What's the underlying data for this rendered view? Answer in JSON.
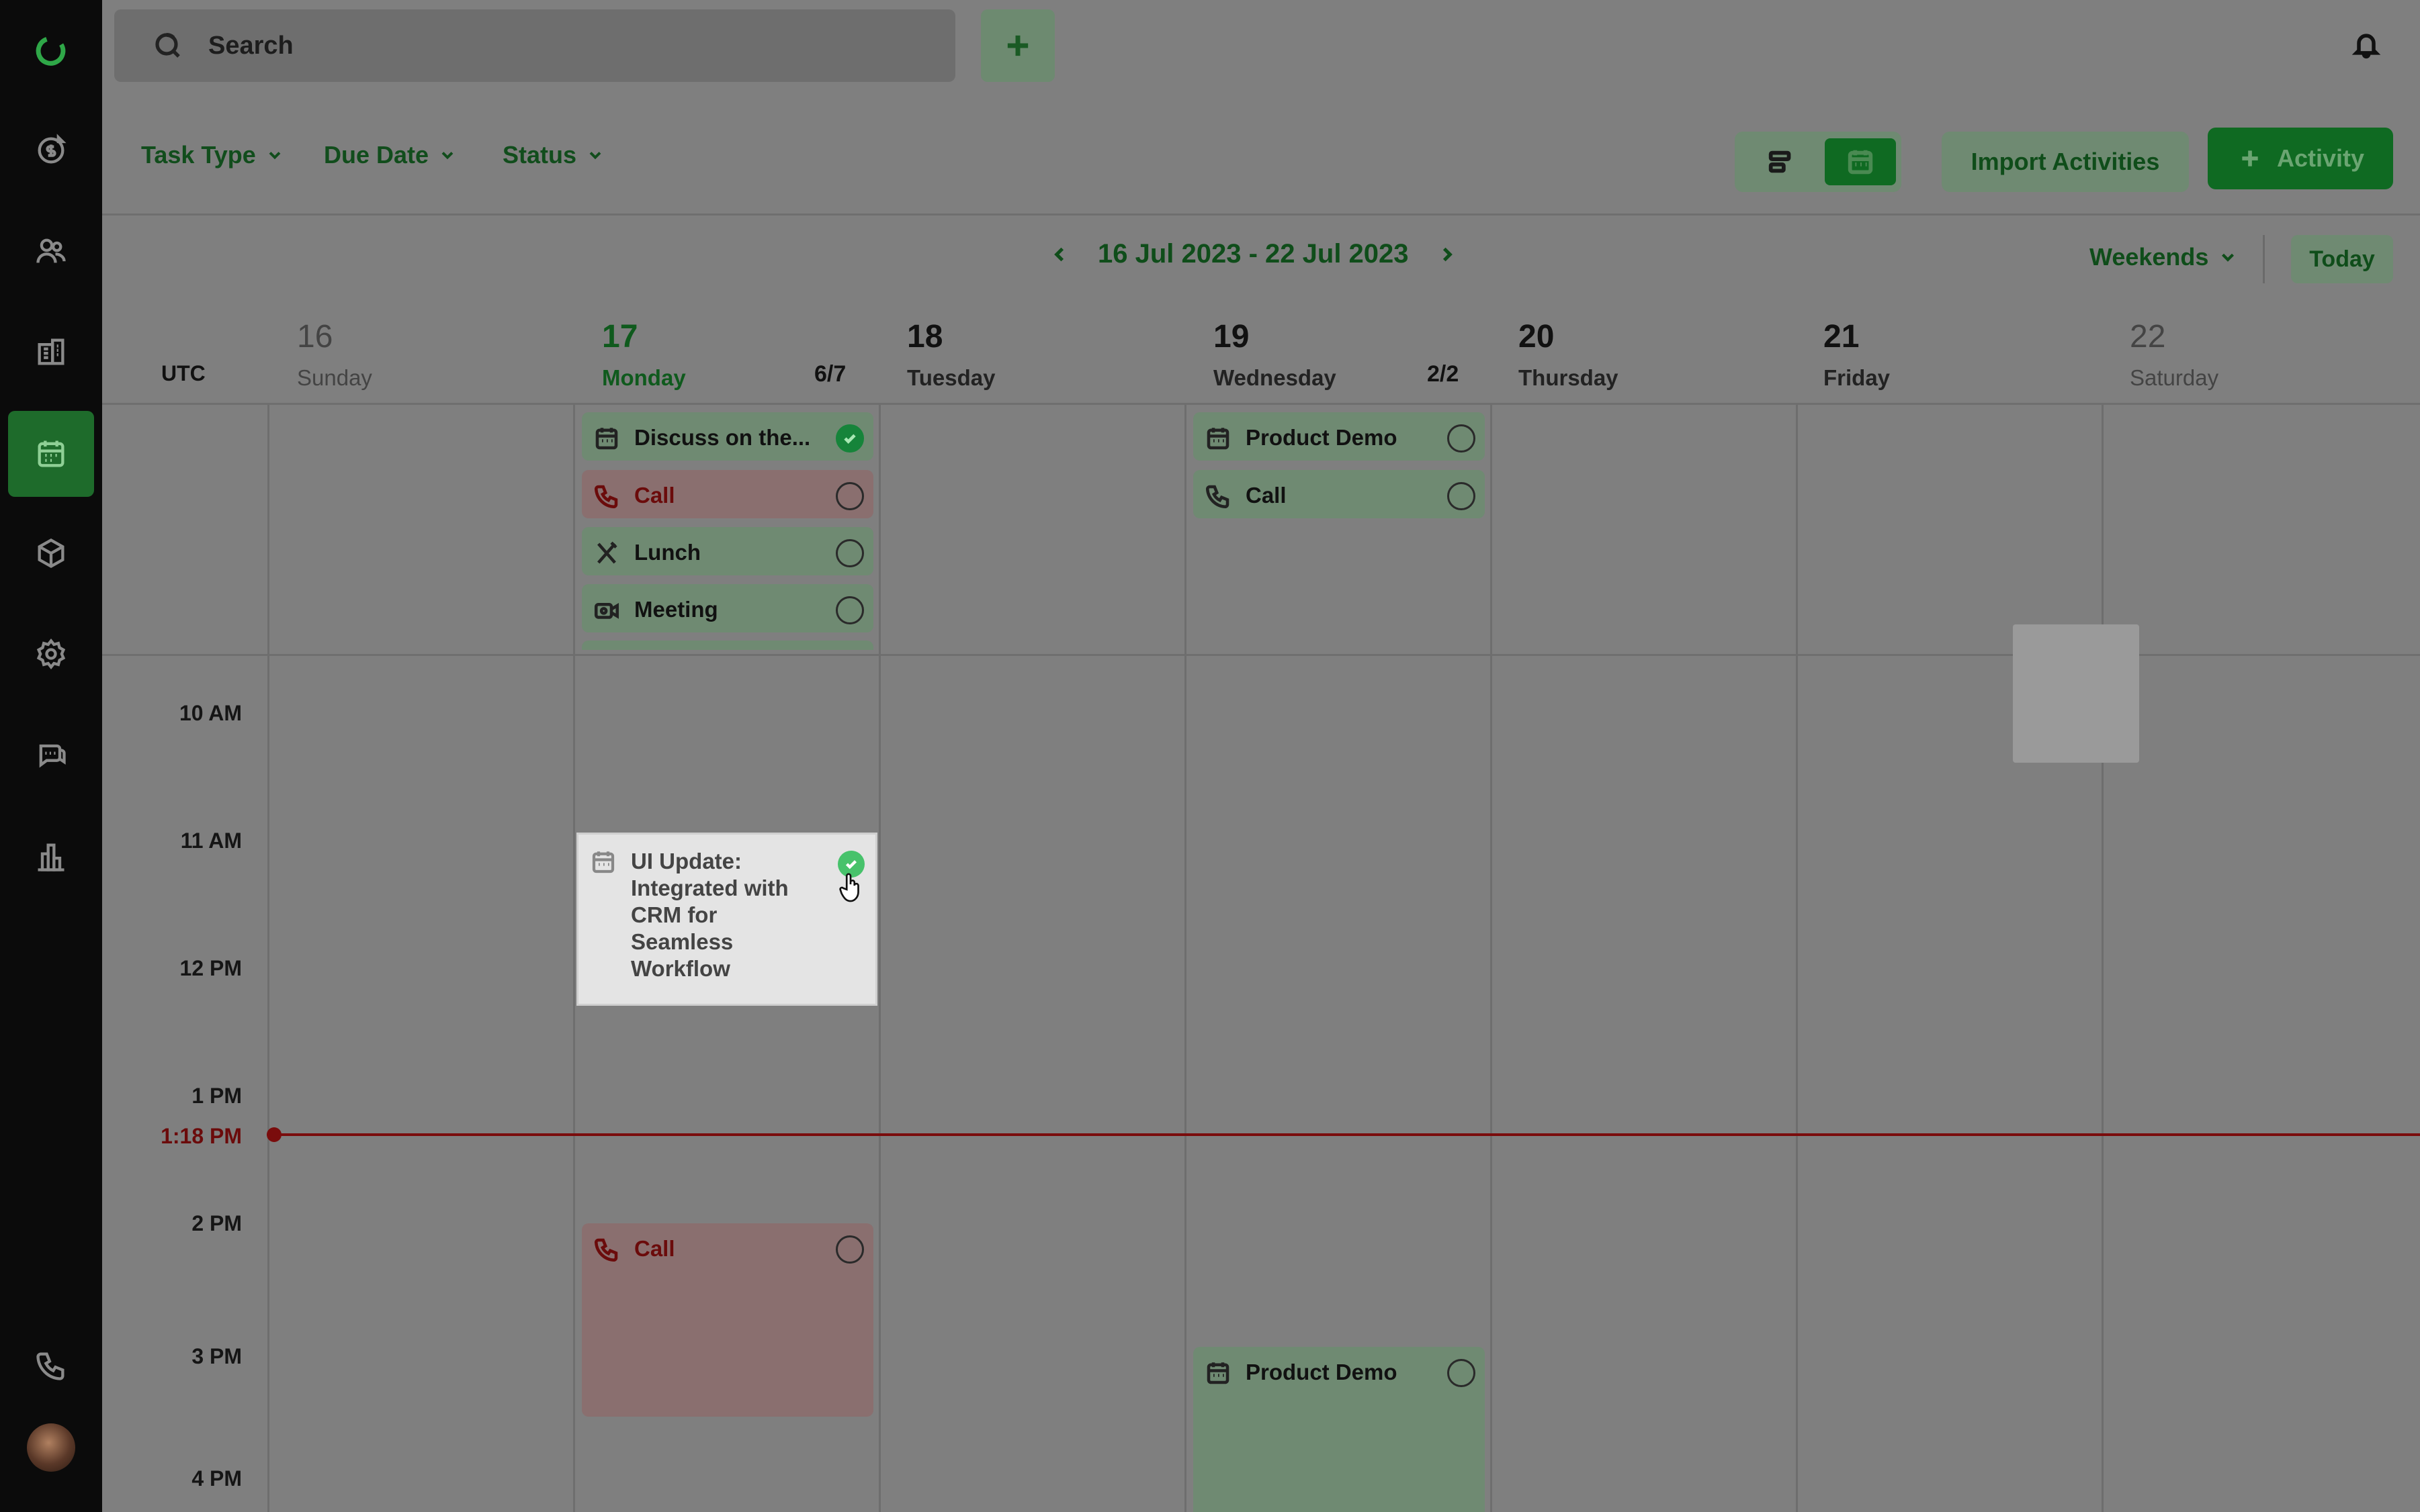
{
  "search": {
    "placeholder": "Search"
  },
  "filters": [
    {
      "label": "Task Type"
    },
    {
      "label": "Due Date"
    },
    {
      "label": "Status"
    }
  ],
  "toolbar": {
    "import_label": "Import Activities",
    "activity_label": "Activity",
    "active_view": "calendar"
  },
  "date_nav": {
    "range": "16 Jul 2023 - 22 Jul 2023",
    "weekends_label": "Weekends",
    "today_label": "Today"
  },
  "calendar": {
    "timezone": "UTC",
    "days": [
      {
        "num": "16",
        "name": "Sunday",
        "count": ""
      },
      {
        "num": "17",
        "name": "Monday",
        "count": "6/7"
      },
      {
        "num": "18",
        "name": "Tuesday",
        "count": ""
      },
      {
        "num": "19",
        "name": "Wednesday",
        "count": "2/2"
      },
      {
        "num": "20",
        "name": "Thursday",
        "count": ""
      },
      {
        "num": "21",
        "name": "Friday",
        "count": ""
      },
      {
        "num": "22",
        "name": "Saturday",
        "count": ""
      }
    ],
    "times": [
      "10 AM",
      "11 AM",
      "12 PM",
      "1 PM",
      "2 PM",
      "3 PM",
      "4 PM"
    ],
    "now_label": "1:18 PM",
    "allday": {
      "monday": [
        {
          "title": "Discuss on the...",
          "type": "event",
          "done": true
        },
        {
          "title": "Call",
          "type": "call",
          "done": false
        },
        {
          "title": "Lunch",
          "type": "lunch",
          "done": false
        },
        {
          "title": "Meeting",
          "type": "meeting",
          "done": false
        }
      ],
      "wednesday": [
        {
          "title": "Product Demo",
          "type": "event",
          "done": false
        },
        {
          "title": "Call",
          "type": "call",
          "done": false
        }
      ]
    },
    "timed": {
      "monday_call": {
        "title": "Call",
        "done": false
      },
      "wednesday_demo": {
        "title": "Product Demo",
        "done": false
      }
    },
    "popup": {
      "title": "UI Update: Integrated with CRM for Seamless Workflow",
      "done": true
    }
  },
  "colors": {
    "accent": "#0f6a22",
    "call_red": "#6b0b0b",
    "now_line": "#7a0c0c"
  },
  "icons": [
    "logo-icon",
    "deals-icon",
    "contacts-icon",
    "companies-icon",
    "calendar-icon",
    "products-icon",
    "settings-icon",
    "chat-icon",
    "reports-icon",
    "phone-icon",
    "bell-icon"
  ]
}
